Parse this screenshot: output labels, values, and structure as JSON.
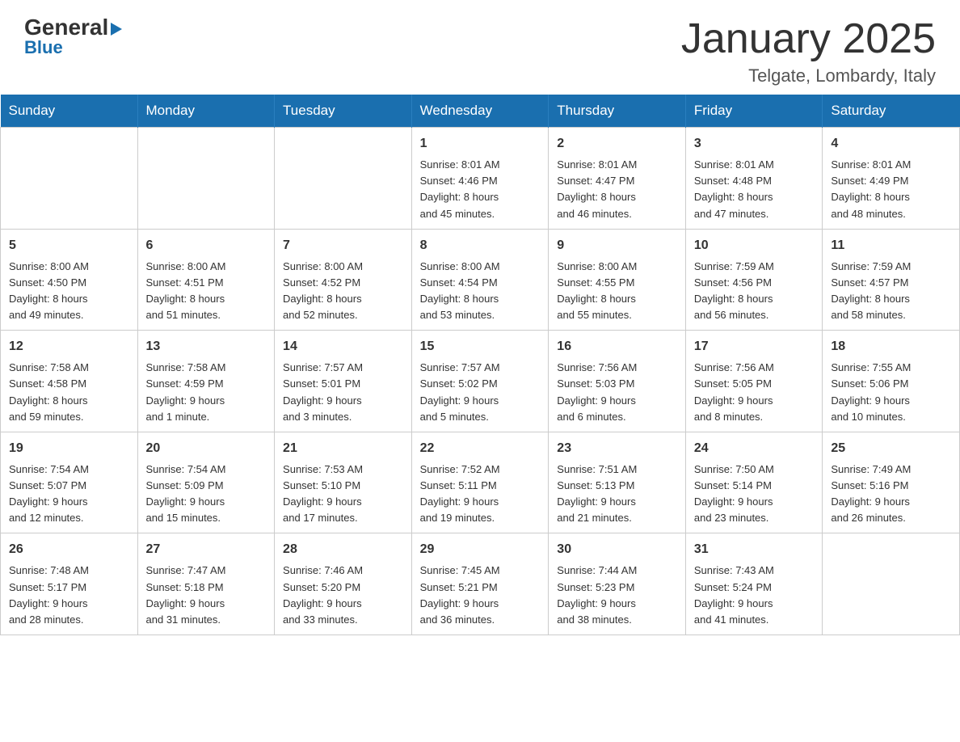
{
  "header": {
    "logo_general": "General",
    "logo_blue": "Blue",
    "month_title": "January 2025",
    "location": "Telgate, Lombardy, Italy"
  },
  "days_of_week": [
    "Sunday",
    "Monday",
    "Tuesday",
    "Wednesday",
    "Thursday",
    "Friday",
    "Saturday"
  ],
  "weeks": [
    [
      {
        "day": "",
        "info": ""
      },
      {
        "day": "",
        "info": ""
      },
      {
        "day": "",
        "info": ""
      },
      {
        "day": "1",
        "info": "Sunrise: 8:01 AM\nSunset: 4:46 PM\nDaylight: 8 hours\nand 45 minutes."
      },
      {
        "day": "2",
        "info": "Sunrise: 8:01 AM\nSunset: 4:47 PM\nDaylight: 8 hours\nand 46 minutes."
      },
      {
        "day": "3",
        "info": "Sunrise: 8:01 AM\nSunset: 4:48 PM\nDaylight: 8 hours\nand 47 minutes."
      },
      {
        "day": "4",
        "info": "Sunrise: 8:01 AM\nSunset: 4:49 PM\nDaylight: 8 hours\nand 48 minutes."
      }
    ],
    [
      {
        "day": "5",
        "info": "Sunrise: 8:00 AM\nSunset: 4:50 PM\nDaylight: 8 hours\nand 49 minutes."
      },
      {
        "day": "6",
        "info": "Sunrise: 8:00 AM\nSunset: 4:51 PM\nDaylight: 8 hours\nand 51 minutes."
      },
      {
        "day": "7",
        "info": "Sunrise: 8:00 AM\nSunset: 4:52 PM\nDaylight: 8 hours\nand 52 minutes."
      },
      {
        "day": "8",
        "info": "Sunrise: 8:00 AM\nSunset: 4:54 PM\nDaylight: 8 hours\nand 53 minutes."
      },
      {
        "day": "9",
        "info": "Sunrise: 8:00 AM\nSunset: 4:55 PM\nDaylight: 8 hours\nand 55 minutes."
      },
      {
        "day": "10",
        "info": "Sunrise: 7:59 AM\nSunset: 4:56 PM\nDaylight: 8 hours\nand 56 minutes."
      },
      {
        "day": "11",
        "info": "Sunrise: 7:59 AM\nSunset: 4:57 PM\nDaylight: 8 hours\nand 58 minutes."
      }
    ],
    [
      {
        "day": "12",
        "info": "Sunrise: 7:58 AM\nSunset: 4:58 PM\nDaylight: 8 hours\nand 59 minutes."
      },
      {
        "day": "13",
        "info": "Sunrise: 7:58 AM\nSunset: 4:59 PM\nDaylight: 9 hours\nand 1 minute."
      },
      {
        "day": "14",
        "info": "Sunrise: 7:57 AM\nSunset: 5:01 PM\nDaylight: 9 hours\nand 3 minutes."
      },
      {
        "day": "15",
        "info": "Sunrise: 7:57 AM\nSunset: 5:02 PM\nDaylight: 9 hours\nand 5 minutes."
      },
      {
        "day": "16",
        "info": "Sunrise: 7:56 AM\nSunset: 5:03 PM\nDaylight: 9 hours\nand 6 minutes."
      },
      {
        "day": "17",
        "info": "Sunrise: 7:56 AM\nSunset: 5:05 PM\nDaylight: 9 hours\nand 8 minutes."
      },
      {
        "day": "18",
        "info": "Sunrise: 7:55 AM\nSunset: 5:06 PM\nDaylight: 9 hours\nand 10 minutes."
      }
    ],
    [
      {
        "day": "19",
        "info": "Sunrise: 7:54 AM\nSunset: 5:07 PM\nDaylight: 9 hours\nand 12 minutes."
      },
      {
        "day": "20",
        "info": "Sunrise: 7:54 AM\nSunset: 5:09 PM\nDaylight: 9 hours\nand 15 minutes."
      },
      {
        "day": "21",
        "info": "Sunrise: 7:53 AM\nSunset: 5:10 PM\nDaylight: 9 hours\nand 17 minutes."
      },
      {
        "day": "22",
        "info": "Sunrise: 7:52 AM\nSunset: 5:11 PM\nDaylight: 9 hours\nand 19 minutes."
      },
      {
        "day": "23",
        "info": "Sunrise: 7:51 AM\nSunset: 5:13 PM\nDaylight: 9 hours\nand 21 minutes."
      },
      {
        "day": "24",
        "info": "Sunrise: 7:50 AM\nSunset: 5:14 PM\nDaylight: 9 hours\nand 23 minutes."
      },
      {
        "day": "25",
        "info": "Sunrise: 7:49 AM\nSunset: 5:16 PM\nDaylight: 9 hours\nand 26 minutes."
      }
    ],
    [
      {
        "day": "26",
        "info": "Sunrise: 7:48 AM\nSunset: 5:17 PM\nDaylight: 9 hours\nand 28 minutes."
      },
      {
        "day": "27",
        "info": "Sunrise: 7:47 AM\nSunset: 5:18 PM\nDaylight: 9 hours\nand 31 minutes."
      },
      {
        "day": "28",
        "info": "Sunrise: 7:46 AM\nSunset: 5:20 PM\nDaylight: 9 hours\nand 33 minutes."
      },
      {
        "day": "29",
        "info": "Sunrise: 7:45 AM\nSunset: 5:21 PM\nDaylight: 9 hours\nand 36 minutes."
      },
      {
        "day": "30",
        "info": "Sunrise: 7:44 AM\nSunset: 5:23 PM\nDaylight: 9 hours\nand 38 minutes."
      },
      {
        "day": "31",
        "info": "Sunrise: 7:43 AM\nSunset: 5:24 PM\nDaylight: 9 hours\nand 41 minutes."
      },
      {
        "day": "",
        "info": ""
      }
    ]
  ]
}
